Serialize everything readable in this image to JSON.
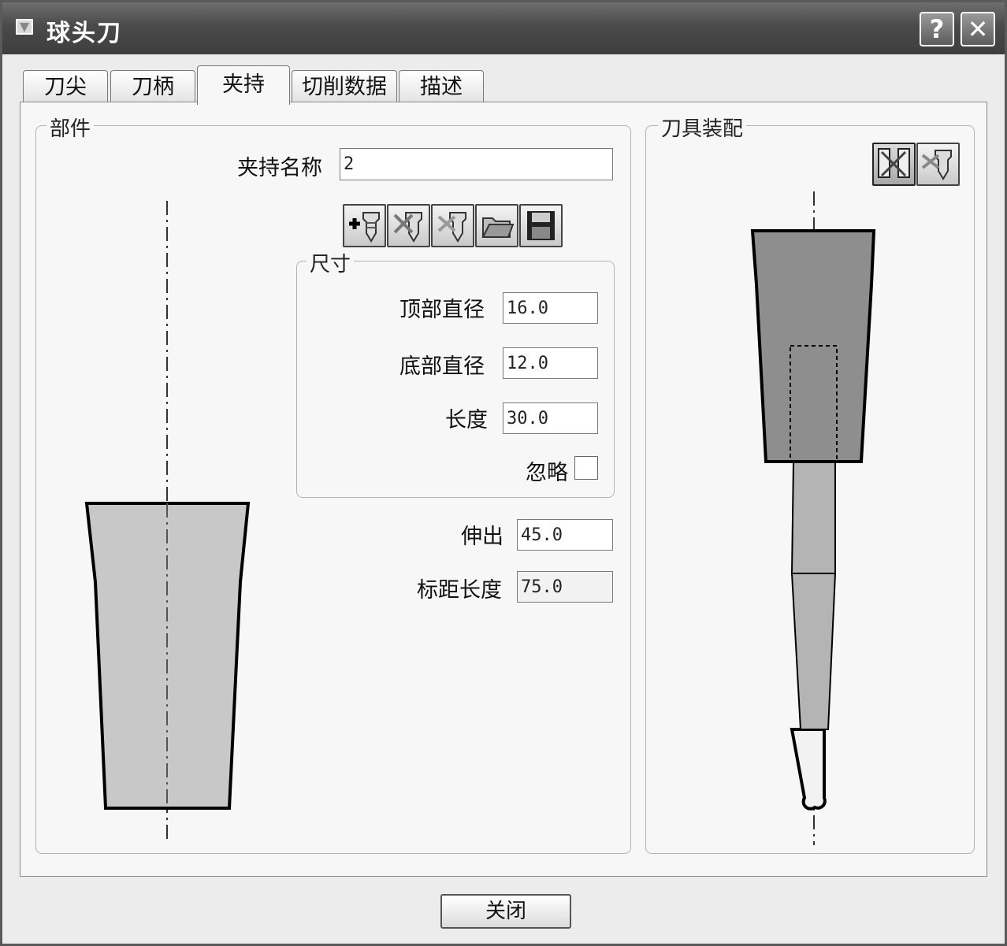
{
  "window": {
    "title": "球头刀",
    "help_button": "?",
    "close_button": "✕"
  },
  "tabs": [
    {
      "label": "刀尖"
    },
    {
      "label": "刀柄"
    },
    {
      "label": "夹持",
      "selected": true
    },
    {
      "label": "切削数据"
    },
    {
      "label": "描述"
    }
  ],
  "part_group": {
    "title": "部件",
    "holder_name_label": "夹持名称",
    "holder_name_value": "2",
    "toolbar_icons": [
      "add-holder-icon",
      "delete-holder-icon",
      "remove-holder-icon",
      "open-folder-icon",
      "save-icon"
    ],
    "dimensions": {
      "title": "尺寸",
      "top_diameter_label": "顶部直径",
      "top_diameter_value": "16.0",
      "bottom_diameter_label": "底部直径",
      "bottom_diameter_value": "12.0",
      "length_label": "长度",
      "length_value": "30.0",
      "ignore_label": "忽略",
      "ignore_checked": false
    },
    "extension_label": "伸出",
    "extension_value": "45.0",
    "gauge_length_label": "标距长度",
    "gauge_length_value": "75.0"
  },
  "assembly_group": {
    "title": "刀具装配",
    "toolbar_icons": [
      "show-holder-icon",
      "tool-assembly-icon"
    ]
  },
  "footer": {
    "close_label": "关闭"
  }
}
